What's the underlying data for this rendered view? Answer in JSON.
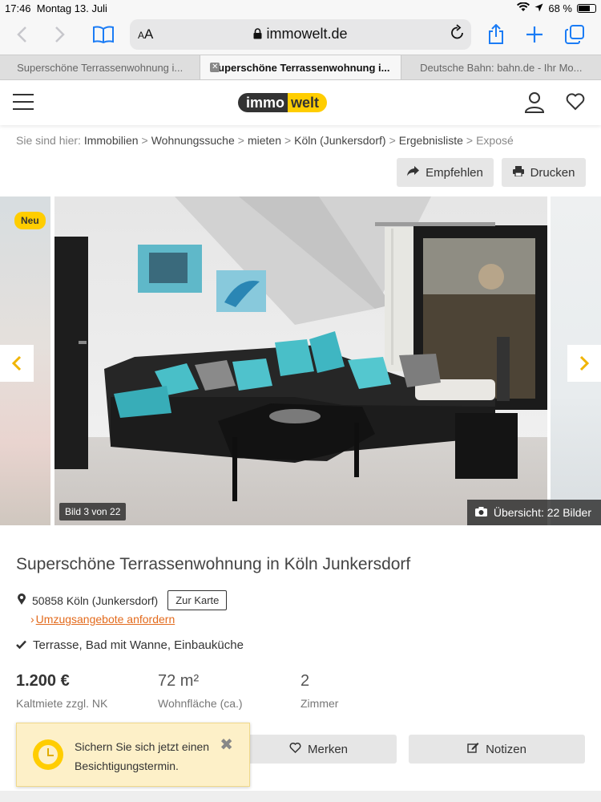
{
  "status_bar": {
    "time": "17:46",
    "date": "Montag 13. Juli",
    "battery": "68 %"
  },
  "browser": {
    "text_size_label": "AA",
    "url": "immowelt.de",
    "tabs": [
      {
        "label": "Superschöne Terrassenwohnung i...",
        "active": false
      },
      {
        "label": "Superschöne Terrassenwohnung i...",
        "active": true
      },
      {
        "label": "Deutsche Bahn: bahn.de - Ihr Mo...",
        "active": false
      }
    ]
  },
  "site": {
    "logo_left": "immo",
    "logo_right": "welt",
    "brand_yellow": "#ffcd00"
  },
  "breadcrumb": {
    "prefix": "Sie sind hier:",
    "items": [
      "Immobilien",
      "Wohnungssuche",
      "mieten",
      "Köln (Junkersdorf)",
      "Ergebnisliste",
      "Exposé"
    ]
  },
  "actions": {
    "recommend": "Empfehlen",
    "print": "Drucken"
  },
  "gallery": {
    "badge": "Neu",
    "counter": "Bild 3 von 22",
    "overview": "Übersicht: 22 Bilder"
  },
  "listing": {
    "title": "Superschöne Terrassenwohnung in Köln Junkersdorf",
    "address": "50858 Köln (Junkersdorf)",
    "map_button": "Zur Karte",
    "moving_offers": "Umzugsangebote anfordern",
    "features": "Terrasse, Bad mit Wanne, Einbauküche",
    "price": "1.200 €",
    "price_label": "Kaltmiete zzgl. NK",
    "area": "72 m²",
    "area_label": "Wohnfläche (ca.)",
    "rooms": "2",
    "rooms_label": "Zimmer",
    "save_button": "Merken",
    "notes_button": "Notizen"
  },
  "toast": {
    "message": "Sichern Sie sich jetzt einen Besichtigungstermin."
  }
}
